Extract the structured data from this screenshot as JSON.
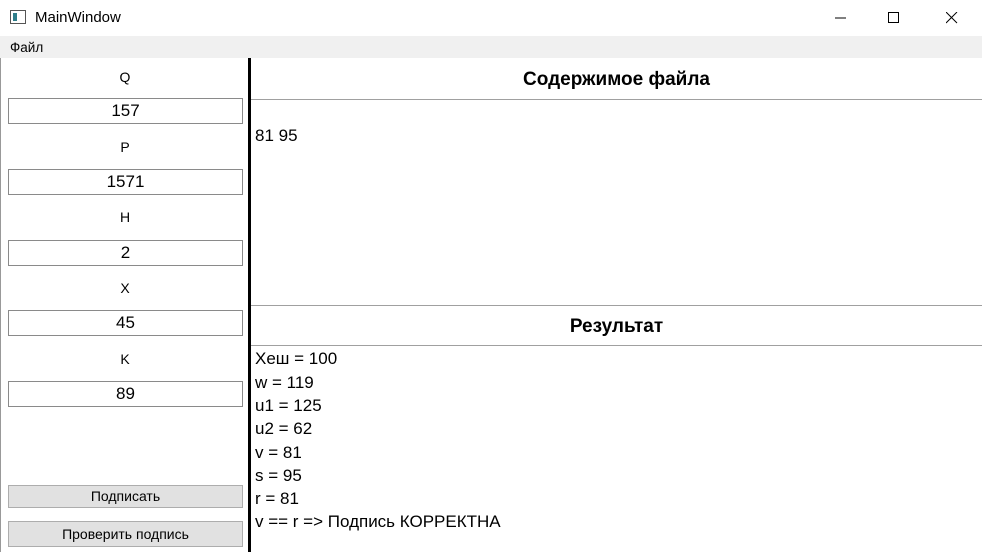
{
  "window": {
    "title": "MainWindow"
  },
  "menu": {
    "file": "Файл"
  },
  "left": {
    "fields": [
      {
        "label": "Q",
        "value": "157"
      },
      {
        "label": "P",
        "value": "1571"
      },
      {
        "label": "H",
        "value": "2"
      },
      {
        "label": "X",
        "value": "45"
      },
      {
        "label": "K",
        "value": "89"
      }
    ],
    "sign_button": "Подписать",
    "verify_button": "Проверить подпись"
  },
  "file_panel": {
    "heading": "Содержимое файла",
    "content": "81 95"
  },
  "result_panel": {
    "heading": "Результат",
    "lines": [
      "Хеш = 100",
      "w = 119",
      "u1 = 125",
      "u2 = 62",
      "v = 81",
      "s = 95",
      "r = 81",
      "v == r => Подпись КОРРЕКТНА"
    ]
  }
}
